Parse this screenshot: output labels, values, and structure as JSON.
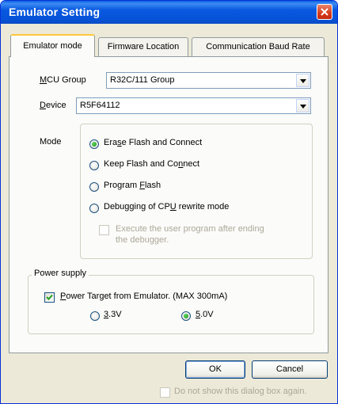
{
  "window": {
    "title": "Emulator Setting",
    "close_label": "close"
  },
  "tabs": [
    "Emulator mode",
    "Firmware Location",
    "Communication Baud Rate"
  ],
  "mcu_group": {
    "label_prefix": "",
    "label_mnemonic": "M",
    "label_rest": "CU Group",
    "value": "R32C/111 Group"
  },
  "device": {
    "label_mnemonic": "D",
    "label_rest": "evice",
    "value": "R5F64112"
  },
  "mode": {
    "label": "Mode",
    "options": [
      {
        "pre": "Era",
        "key": "s",
        "post": "e Flash and Connect"
      },
      {
        "pre": "Keep Flash and Co",
        "key": "n",
        "post": "nect"
      },
      {
        "pre": "Program ",
        "key": "F",
        "post": "lash"
      },
      {
        "pre": "Debugging of CP",
        "key": "U",
        "post": " rewrite mode"
      }
    ],
    "execute_line1": "Execute the user program after ending",
    "execute_line2": "the debugger."
  },
  "power": {
    "legend": "Power supply",
    "check_key": "P",
    "check_rest": "ower Target from Emulator. (MAX 300mA)",
    "v33_key": "3",
    "v33_rest": ".3V",
    "v50_key": "5",
    "v50_rest": ".0V"
  },
  "buttons": {
    "ok": "OK",
    "cancel": "Cancel"
  },
  "footer_check": "Do not show this dialog box again."
}
